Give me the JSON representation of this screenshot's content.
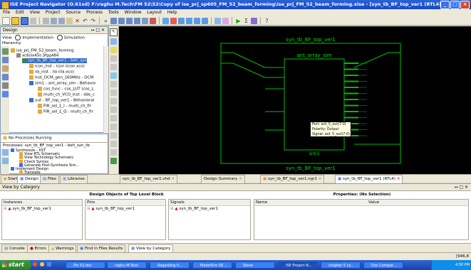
{
  "window": {
    "title": "ISE Project Navigator (O.61xd)  F:\\raghu M.Tech\\FM 52\\52\\Copy of ise_prj_sp605_FM_52_beam_forming\\ise_prj_FM_52_beam_forming.xise - [syn_tb_BF_top_ver1 (RTL4)]"
  },
  "menu": [
    "File",
    "Edit",
    "View",
    "Project",
    "Source",
    "Process",
    "Tools",
    "Window",
    "Layout",
    "Help"
  ],
  "design_panel": {
    "header": "Design",
    "view_label": "View:",
    "view_impl": "Implementation",
    "view_sim": "Simulation",
    "hierarchy_label": "Hierarchy",
    "tree": [
      "ise_prj_FM_52_beam_forming",
      "xc6slx45t-3fgg484",
      "syn_tb_BF_top_ver1 - beh_syn",
      "icon_inst - icon (icon.xco)",
      "ila_inst - ila (ila.xco)",
      "Inst_DCM_gen_160MHz - DCM",
      "sim1 - ant_array_sim - Behavio",
      "cos_func - cos_LUT (cos_L",
      "multi_ch_VCO_inst - dds_c",
      "uut - BF_top_ver1 - Behavioral",
      "FIR_sel_1_I - multi_ch_fir",
      "FIR_sel_1_Q - multi_ch_fir"
    ]
  },
  "processes_panel": {
    "no_processes": "No Processes Running",
    "processes_label": "Processes: syn_tb_BF_top_ver1 - beh_syn_tb",
    "items": [
      "Synthesize - XST",
      "View RTL Schematic",
      "View Technology Schematic",
      "Check Syntax",
      "Generate Post-Synthesis Sim...",
      "Implement Design",
      "Translate"
    ]
  },
  "left_tabs": [
    "Start",
    "Design",
    "Files",
    "Libraries"
  ],
  "schematic": {
    "outer_title": "syn_tb_BF_top_ver1",
    "outer_bottom": "syn_tb_BF_top_ver1",
    "inner_title": "ant_array_sim",
    "inner_bottom": "sim1",
    "tooltip_lines": [
      "Port: ant_5_out(7:0)",
      "Polarity: Output",
      "Signal: ant_5_out(7:0)"
    ]
  },
  "doc_tabs": [
    "syn_tb_BF_top_ver1.vhd",
    "Design Summary",
    "syn_tb_BF_top_ver1.ngr1",
    "syn_tb_BF_top_ver1 (RTL4)"
  ],
  "view_by_category": {
    "header": "View by Category",
    "left_title": "Design Objects of Top Level Block",
    "right_title": "Properties: (No Selection)",
    "columns": [
      "Instances",
      "Pins",
      "Signals"
    ],
    "rows": [
      "syn_tb_BF_top_ver1",
      "syn_tb_BF_top_ver1",
      "syn_tb_BF_top_ver1"
    ],
    "prop_columns": [
      "Name",
      "Value"
    ]
  },
  "console_tabs": [
    "Console",
    "Errors",
    "Warnings",
    "Find in Files Results",
    "View by Category"
  ],
  "status_text": "[946,8",
  "taskbar": {
    "start": "start",
    "items": [
      "Pin 52.doc",
      "raghu M.Tech",
      "Regarding ti...",
      "ModelSim SE ...",
      "Steve",
      "ISE Project N...",
      "chapter 5 cy...",
      "Doc Compar..."
    ],
    "clock": "4:58 PM"
  }
}
